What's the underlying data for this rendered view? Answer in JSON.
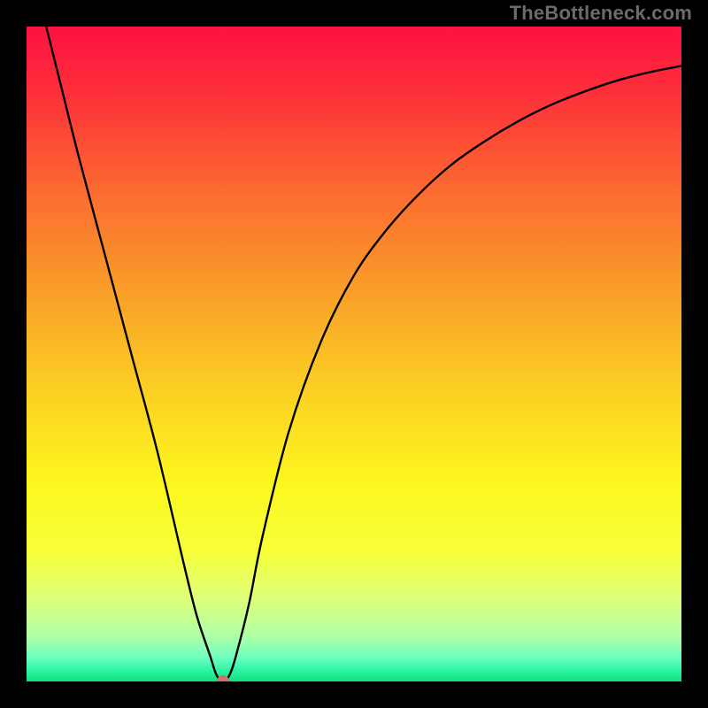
{
  "watermark": "TheBottleneck.com",
  "chart_data": {
    "type": "line",
    "title": "",
    "xlabel": "",
    "ylabel": "",
    "xlim": [
      0,
      100
    ],
    "ylim": [
      0,
      100
    ],
    "series": [
      {
        "name": "bottleneck-curve",
        "x": [
          3,
          5,
          8,
          12,
          16,
          20,
          24,
          26,
          28,
          29,
          30,
          31,
          32,
          34,
          36,
          40,
          45,
          50,
          55,
          60,
          65,
          70,
          75,
          80,
          85,
          90,
          95,
          100
        ],
        "y": [
          100,
          92,
          80,
          65,
          50,
          35,
          18,
          10,
          4,
          1,
          0,
          1,
          4,
          12,
          22,
          38,
          52,
          62,
          69,
          74.5,
          79,
          82.5,
          85.5,
          88,
          90,
          91.7,
          93,
          94
        ]
      }
    ],
    "marker": {
      "x": 30,
      "y": 0,
      "color": "#c9766e"
    },
    "gradient_stops": [
      {
        "pos": 0.0,
        "color": "#fd1242"
      },
      {
        "pos": 0.1,
        "color": "#fd2f3a"
      },
      {
        "pos": 0.25,
        "color": "#fb6a30"
      },
      {
        "pos": 0.4,
        "color": "#fa9d29"
      },
      {
        "pos": 0.55,
        "color": "#fbce23"
      },
      {
        "pos": 0.7,
        "color": "#fcf71e"
      },
      {
        "pos": 0.8,
        "color": "#f6ff39"
      },
      {
        "pos": 0.87,
        "color": "#e0ff76"
      },
      {
        "pos": 0.93,
        "color": "#b0ffa6"
      },
      {
        "pos": 0.965,
        "color": "#6affbf"
      },
      {
        "pos": 0.985,
        "color": "#28f2a0"
      },
      {
        "pos": 1.0,
        "color": "#12e07d"
      }
    ],
    "background_frame_color": "#000000",
    "curve_color": "#000000",
    "curve_width": 2.4
  }
}
